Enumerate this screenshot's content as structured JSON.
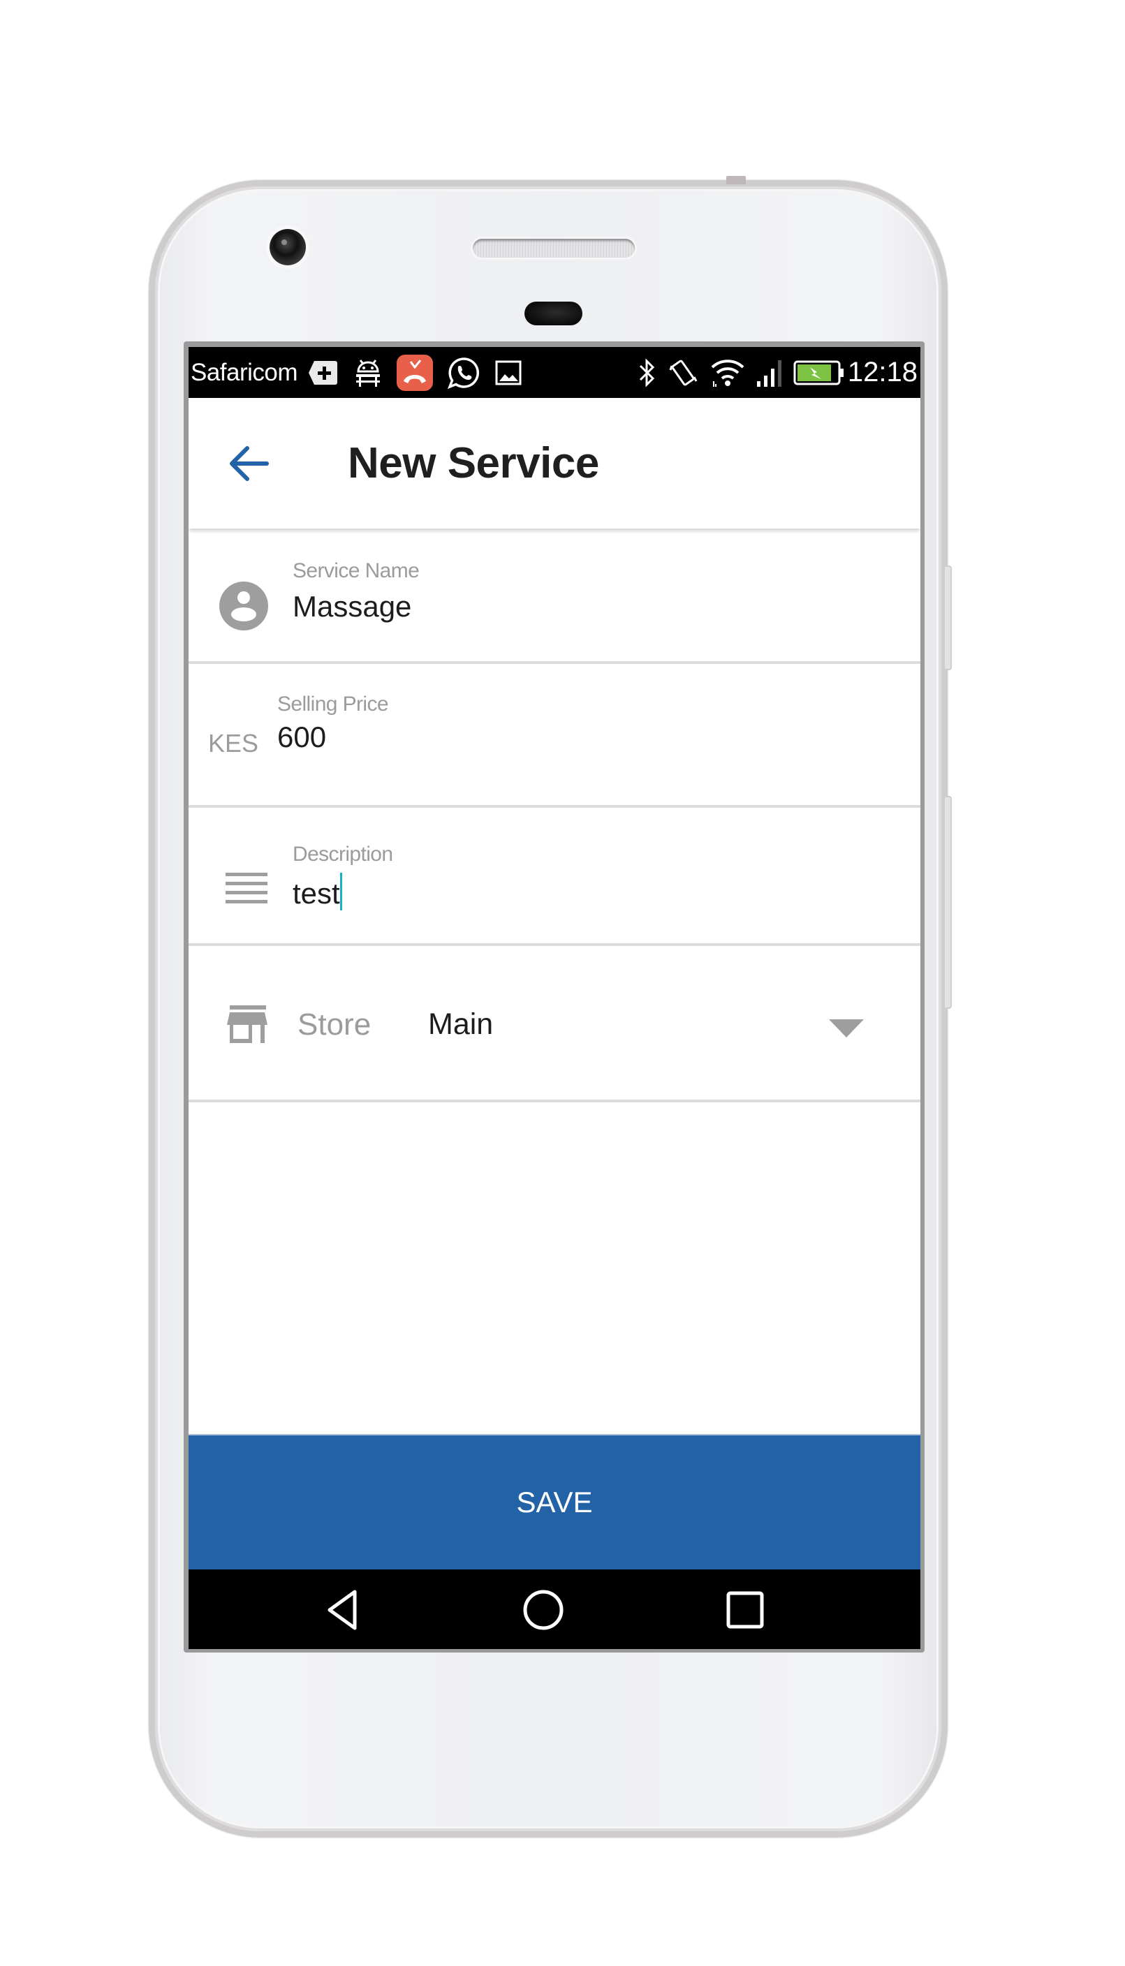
{
  "status_bar": {
    "carrier": "Safaricom",
    "time": "12:18",
    "left_icons": [
      "plus-badge-icon",
      "android-debug-icon",
      "missed-call-icon",
      "whatsapp-icon",
      "image-icon"
    ],
    "right_icons": [
      "bluetooth-icon",
      "vibrate-icon",
      "wifi-icon",
      "cell-signal-icon",
      "battery-charging-icon"
    ],
    "missed_call_color": "#e8604a",
    "battery_color": "#7dc242"
  },
  "app_bar": {
    "title": "New Service",
    "back_icon": "arrow-left-icon",
    "accent_color": "#2163a6"
  },
  "form": {
    "service_name": {
      "label": "Service Name",
      "value": "Massage",
      "icon": "account-circle-icon"
    },
    "selling_price": {
      "label": "Selling Price",
      "currency": "KES",
      "value": "600"
    },
    "description": {
      "label": "Description",
      "value": "test",
      "icon": "notes-icon",
      "cursor_color": "#16b3c6"
    },
    "store": {
      "label": "Store",
      "selected": "Main",
      "icon": "store-icon"
    }
  },
  "actions": {
    "save_label": "SAVE",
    "save_color": "#2163a6"
  },
  "nav_bar": {
    "buttons": [
      "back-triangle-icon",
      "home-circle-icon",
      "recents-square-icon"
    ]
  }
}
